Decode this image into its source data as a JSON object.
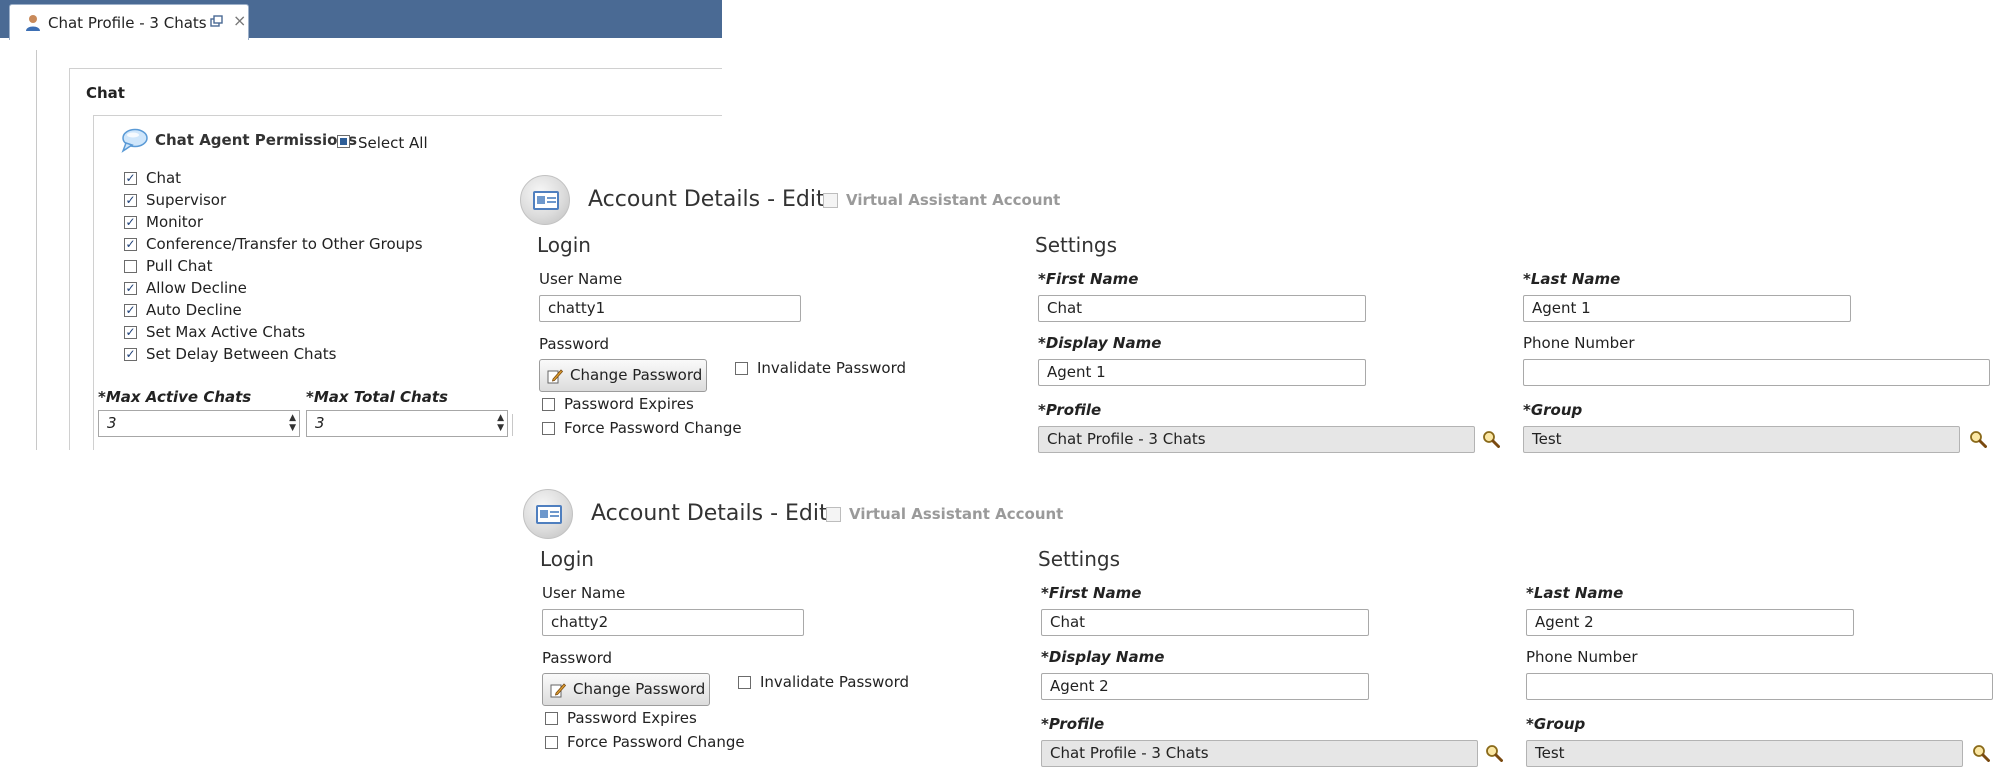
{
  "chat_window": {
    "tab_title": "Chat Profile - 3 Chats",
    "close_glyph": "×",
    "section_title": "Chat",
    "permissions_title": "Chat Agent Permissions",
    "select_all_label": "Select All",
    "permissions": [
      {
        "label": "Chat",
        "checked": true
      },
      {
        "label": "Supervisor",
        "checked": true
      },
      {
        "label": "Monitor",
        "checked": true
      },
      {
        "label": "Conference/Transfer to Other Groups",
        "checked": true
      },
      {
        "label": "Pull Chat",
        "checked": false
      },
      {
        "label": "Allow Decline",
        "checked": true
      },
      {
        "label": "Auto Decline",
        "checked": true
      },
      {
        "label": "Set Max Active Chats",
        "checked": true
      },
      {
        "label": "Set Delay Between Chats",
        "checked": true
      }
    ],
    "max_active_label": "*Max Active Chats",
    "max_active_value": "3",
    "max_total_label": "*Max Total Chats",
    "max_total_value": "3"
  },
  "accounts": [
    {
      "title": "Account Details - Edit",
      "va_label": "Virtual Assistant Account",
      "login_title": "Login",
      "username_label": "User Name",
      "username_value": "chatty1",
      "password_label": "Password",
      "change_password_label": "Change Password",
      "invalidate_password_label": "Invalidate Password",
      "password_expires_label": "Password Expires",
      "force_change_label": "Force Password Change",
      "settings_title": "Settings",
      "first_name_label": "*First Name",
      "first_name_value": "Chat",
      "last_name_label": "*Last Name",
      "last_name_value": "Agent 1",
      "display_name_label": "*Display Name",
      "display_name_value": "Agent 1",
      "phone_label": "Phone Number",
      "phone_value": "",
      "profile_label": "*Profile",
      "profile_value": "Chat Profile - 3 Chats",
      "group_label": "*Group",
      "group_value": "Test"
    },
    {
      "title": "Account Details - Edit",
      "va_label": "Virtual Assistant Account",
      "login_title": "Login",
      "username_label": "User Name",
      "username_value": "chatty2",
      "password_label": "Password",
      "change_password_label": "Change Password",
      "invalidate_password_label": "Invalidate Password",
      "password_expires_label": "Password Expires",
      "force_change_label": "Force Password Change",
      "settings_title": "Settings",
      "first_name_label": "*First Name",
      "first_name_value": "Chat",
      "last_name_label": "*Last Name",
      "last_name_value": "Agent 2",
      "display_name_label": "*Display Name",
      "display_name_value": "Agent 2",
      "phone_label": "Phone Number",
      "phone_value": "",
      "profile_label": "*Profile",
      "profile_value": "Chat Profile - 3 Chats",
      "group_label": "*Group",
      "group_value": "Test"
    }
  ]
}
